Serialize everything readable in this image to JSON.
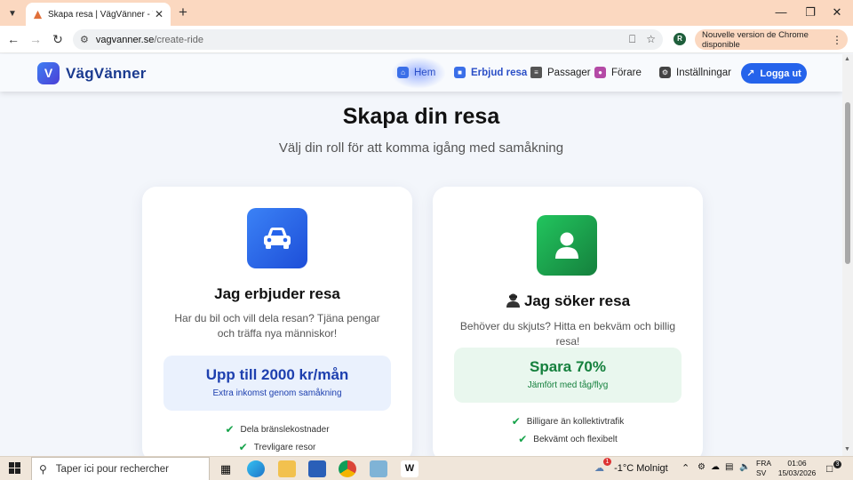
{
  "browser": {
    "tab_title": "Skapa resa | VägVänner - Välj d",
    "url_host": "vagvanner.se",
    "url_path": "/create-ride",
    "profile_initial": "R",
    "update_notice": "Nouvelle version de Chrome disponible"
  },
  "site": {
    "logo_letter": "V",
    "logo_text": "VägVänner",
    "nav": [
      {
        "label": "Hem",
        "icon": "home-icon"
      },
      {
        "label": "Erbjud resa",
        "icon": "car-icon"
      },
      {
        "label": "Passager",
        "icon": "clipboard-icon"
      },
      {
        "label": "Förare",
        "icon": "driver-icon"
      },
      {
        "label": "Inställningar",
        "icon": "gear-icon"
      }
    ],
    "login_label": "Logga ut"
  },
  "main": {
    "title": "Skapa din resa",
    "subtitle": "Välj din roll för att komma igång med samåkning",
    "cards": [
      {
        "title": "Jag erbjuder resa",
        "description": "Har du bil och vill dela resan? Tjäna pengar och träffa nya människor!",
        "highlight_big": "Upp till 2000 kr/mån",
        "highlight_small": "Extra inkomst genom samåkning",
        "features": [
          "Dela bränslekostnader",
          "Trevligare resor"
        ],
        "icon": "car-icon",
        "accent": "#2563eb"
      },
      {
        "title": "Jag söker resa",
        "description": "Behöver du skjuts? Hitta en bekväm och billig resa!",
        "highlight_big": "Spara 70%",
        "highlight_small": "Jämfört med tåg/flyg",
        "features": [
          "Billigare än kollektivtrafik",
          "Bekvämt och flexibelt"
        ],
        "icon": "user-icon",
        "accent": "#16a34a"
      }
    ]
  },
  "taskbar": {
    "search_placeholder": "Taper ici pour rechercher",
    "weather": "-1°C  Molnigt",
    "weather_badge": "1",
    "lang_top": "FRA",
    "lang_bottom": "SV",
    "time": "01:06",
    "date": "15/03/2026",
    "notification_count": "3"
  }
}
